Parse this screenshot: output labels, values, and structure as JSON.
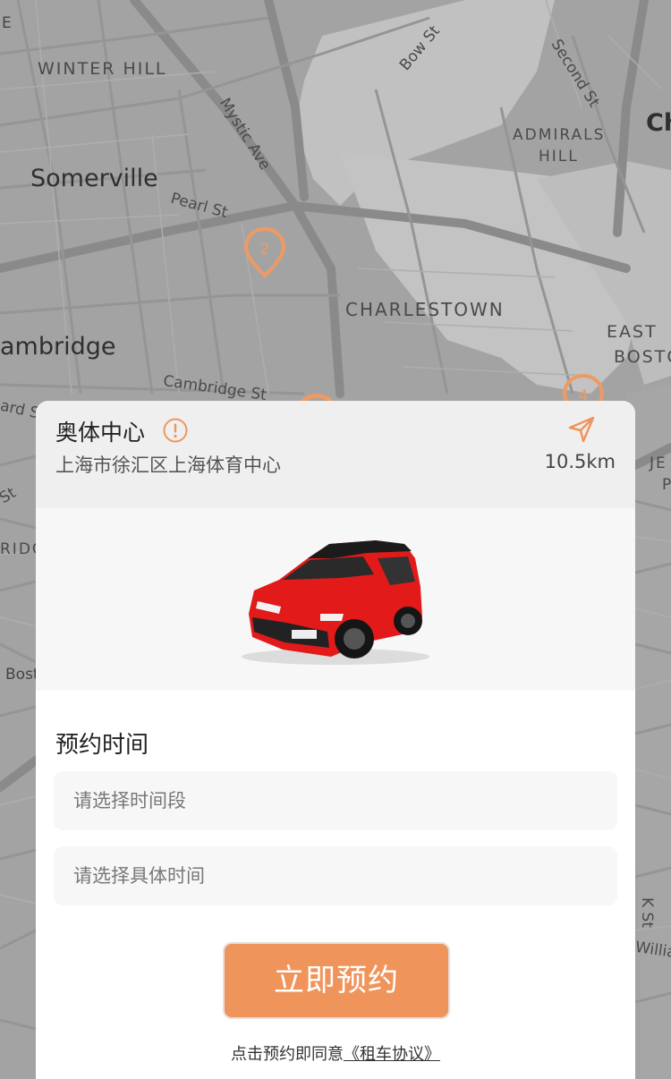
{
  "map": {
    "labels": {
      "winter_hill": "WINTER HILL",
      "somerville": "Somerville",
      "cambridge": "ambridge",
      "charlestown": "CHARLESTOWN",
      "admirals": "ADMIRALS",
      "hill": "HILL",
      "east": "EAST",
      "boston": "BOSTON",
      "ch": "Ch",
      "bow_st": "Bow St",
      "second_st": "Second St",
      "mystic_ave": "Mystic Ave",
      "pearl_st": "Pearl St",
      "cambridge_st": "Cambridge St",
      "ard_s": "ard S",
      "st": "St",
      "ridg": "RIDG",
      "bost": "Bost",
      "je": "JE",
      "p": "P",
      "k_st": "K St",
      "willia": "Willia",
      "e": "E"
    },
    "pins": [
      {
        "label": "2",
        "color": "#ee9a64"
      },
      {
        "label": "4",
        "color": "#ee9a64"
      }
    ]
  },
  "station": {
    "name": "奥体中心",
    "address": "上海市徐汇区上海体育中心",
    "distance": "10.5km",
    "info_icon": "info-circle-icon",
    "nav_icon": "navigation-arrow-icon",
    "accent_color": "#ef955c"
  },
  "booking": {
    "section_title": "预约时间",
    "slot_placeholder": "请选择时间段",
    "time_placeholder": "请选择具体时间",
    "button_label": "立即预约",
    "agreement_text": "点击预约即同意",
    "agreement_link": "《租车协议》"
  }
}
